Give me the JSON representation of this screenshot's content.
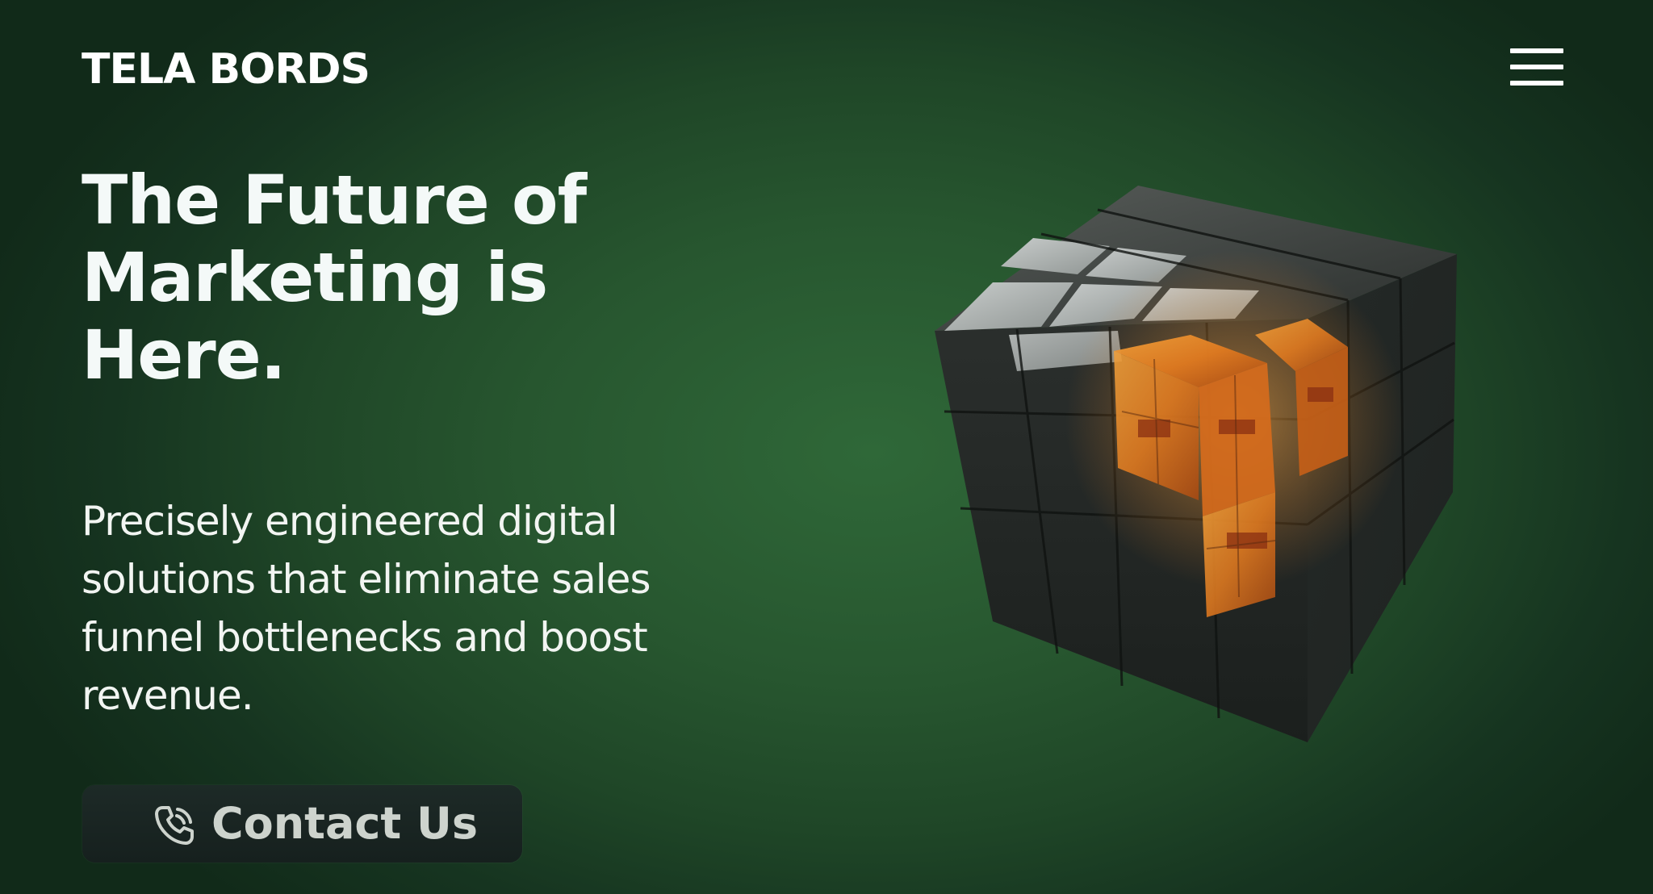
{
  "header": {
    "logo_text": "TELA BORDS",
    "menu_icon": "hamburger-menu-icon"
  },
  "hero": {
    "headline": "The Future of Marketing is Here.",
    "subheadline": "Precisely engineered digital solutions that eliminate sales funnel bottlenecks and boost revenue.",
    "cta": {
      "label": "Contact Us",
      "icon": "phone-call-icon"
    },
    "image": {
      "subject": "3D dark cube with glowing orange core"
    }
  },
  "colors": {
    "background_center": "#2f6838",
    "background_edge": "#112a19",
    "text": "#f4f9f8",
    "button_bg": "#1a2522",
    "button_text": "#cdd3cd",
    "accent_orange": "#e8892a"
  }
}
